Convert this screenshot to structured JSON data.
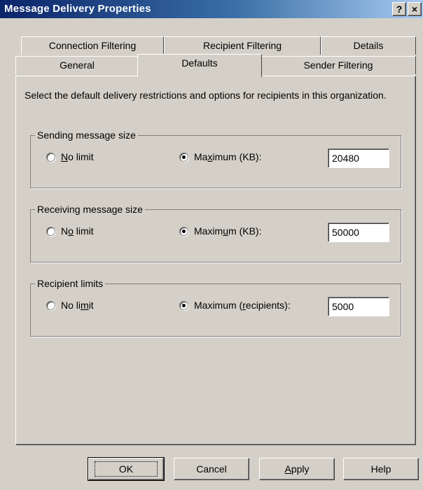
{
  "window": {
    "title": "Message Delivery Properties",
    "help_glyph": "?",
    "close_glyph": "×"
  },
  "tabs": {
    "row1": [
      "Connection Filtering",
      "Recipient Filtering",
      "Details"
    ],
    "row2": [
      "General",
      "Defaults",
      "Sender Filtering"
    ],
    "active": "Defaults"
  },
  "intro": "Select the default delivery restrictions and options for recipients in this organization.",
  "groups": [
    {
      "title": "Sending message size",
      "no_limit": {
        "pre": "",
        "key": "N",
        "post": "o limit"
      },
      "maximum": {
        "pre": "Ma",
        "key": "x",
        "post": "imum (KB):"
      },
      "value": "20480",
      "selected": "maximum"
    },
    {
      "title": "Receiving message size",
      "no_limit": {
        "pre": "N",
        "key": "o",
        "post": " limit"
      },
      "maximum": {
        "pre": "Maxim",
        "key": "u",
        "post": "m (KB):"
      },
      "value": "50000",
      "selected": "maximum"
    },
    {
      "title": "Recipient limits",
      "no_limit": {
        "pre": "No li",
        "key": "m",
        "post": "it"
      },
      "maximum": {
        "pre": "Maximum (",
        "key": "r",
        "post": "ecipients):"
      },
      "value": "5000",
      "selected": "maximum"
    }
  ],
  "buttons": {
    "ok": "OK",
    "cancel": "Cancel",
    "apply": {
      "key": "A",
      "post": "pply"
    },
    "help": "Help"
  }
}
